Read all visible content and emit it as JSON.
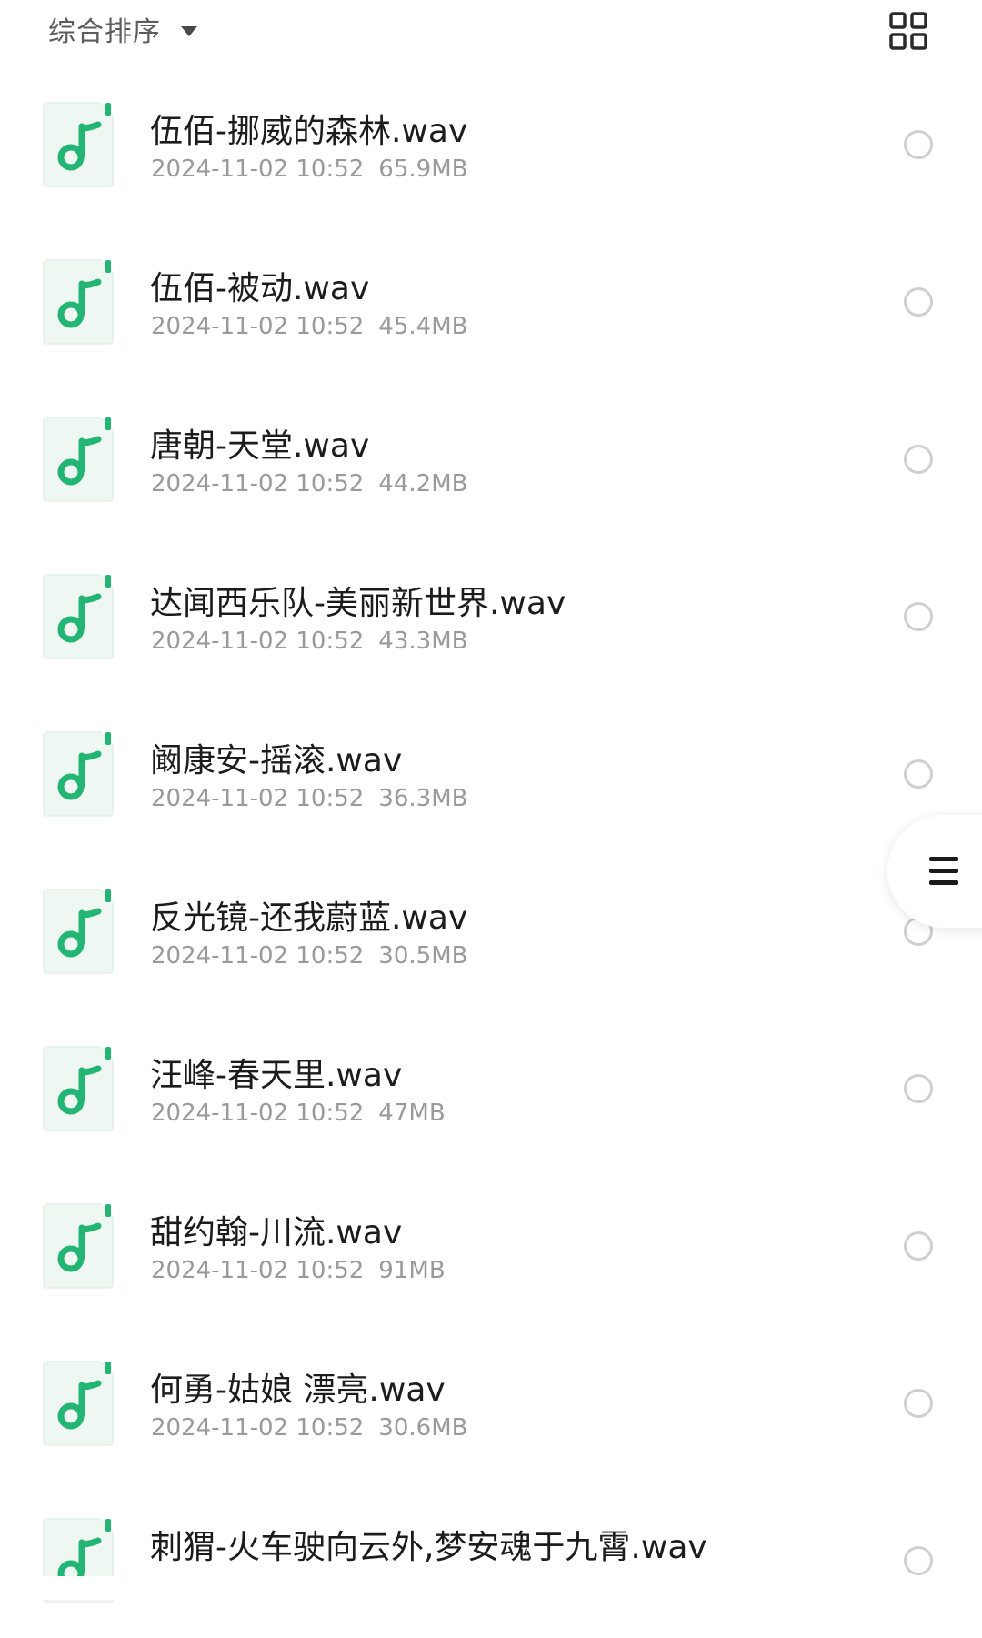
{
  "header": {
    "sort_label": "综合排序",
    "sort_caret_icon": "caret-down-icon",
    "view_toggle_icon": "grid-view-icon"
  },
  "files": [
    {
      "name": "伍佰-挪威的森林.wav",
      "date": "2024-11-02 10:52",
      "size": "65.9MB"
    },
    {
      "name": "伍佰-被动.wav",
      "date": "2024-11-02 10:52",
      "size": "45.4MB"
    },
    {
      "name": "唐朝-天堂.wav",
      "date": "2024-11-02 10:52",
      "size": "44.2MB"
    },
    {
      "name": "达闻西乐队-美丽新世界.wav",
      "date": "2024-11-02 10:52",
      "size": "43.3MB"
    },
    {
      "name": "阚康安-摇滚.wav",
      "date": "2024-11-02 10:52",
      "size": "36.3MB"
    },
    {
      "name": "反光镜-还我蔚蓝.wav",
      "date": "2024-11-02 10:52",
      "size": "30.5MB"
    },
    {
      "name": "汪峰-春天里.wav",
      "date": "2024-11-02 10:52",
      "size": "47MB"
    },
    {
      "name": "甜约翰-川流.wav",
      "date": "2024-11-02 10:52",
      "size": "91MB"
    },
    {
      "name": "何勇-姑娘 漂亮.wav",
      "date": "2024-11-02 10:52",
      "size": "30.6MB"
    },
    {
      "name": "刺猬-火车驶向云外,梦安魂于九霄.wav",
      "date": "",
      "size": ""
    }
  ],
  "file_icon": "music-file-icon",
  "float_menu_icon": "menu-icon",
  "colors": {
    "accent_green": "#22b573",
    "icon_bg": "#eef7f1",
    "meta_text": "#9a9a9a",
    "radio_border": "#cfcfcf"
  }
}
